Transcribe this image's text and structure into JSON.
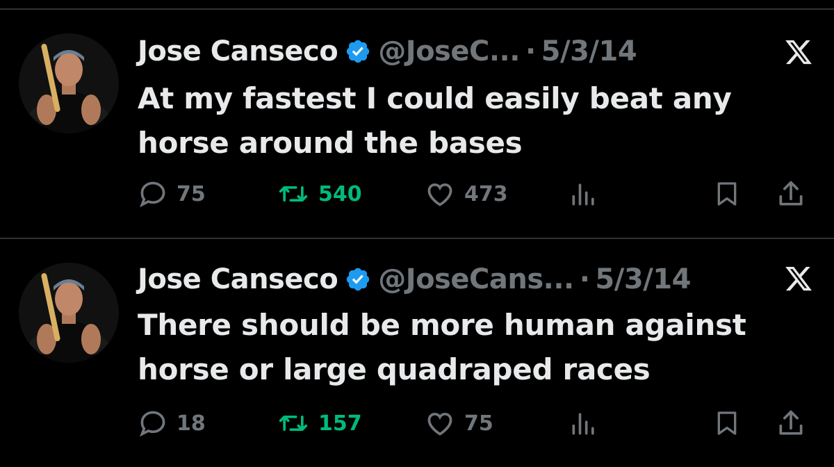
{
  "colors": {
    "background": "#000000",
    "text_primary": "#e7e9ea",
    "text_secondary": "#71767b",
    "verified_blue": "#1d9bf0",
    "retweet_green": "#00ba7c",
    "divider": "#2f3336"
  },
  "tweets": [
    {
      "name": "Jose Canseco",
      "handle": "@JoseC...",
      "separator": "·",
      "date": "5/3/14",
      "text": "At my fastest I could easily beat any horse around the bases",
      "replies": "75",
      "retweets": "540",
      "likes": "473",
      "icons": [
        "avatar",
        "verified-badge-icon",
        "x-logo-icon",
        "reply-icon",
        "retweet-icon",
        "like-icon",
        "views-icon",
        "bookmark-icon",
        "share-icon"
      ]
    },
    {
      "name": "Jose Canseco",
      "handle": "@JoseCans...",
      "separator": "·",
      "date": "5/3/14",
      "text": "There should be more human against horse or large quadraped races",
      "replies": "18",
      "retweets": "157",
      "likes": "75",
      "icons": [
        "avatar",
        "verified-badge-icon",
        "x-logo-icon",
        "reply-icon",
        "retweet-icon",
        "like-icon",
        "views-icon",
        "bookmark-icon",
        "share-icon"
      ]
    }
  ]
}
